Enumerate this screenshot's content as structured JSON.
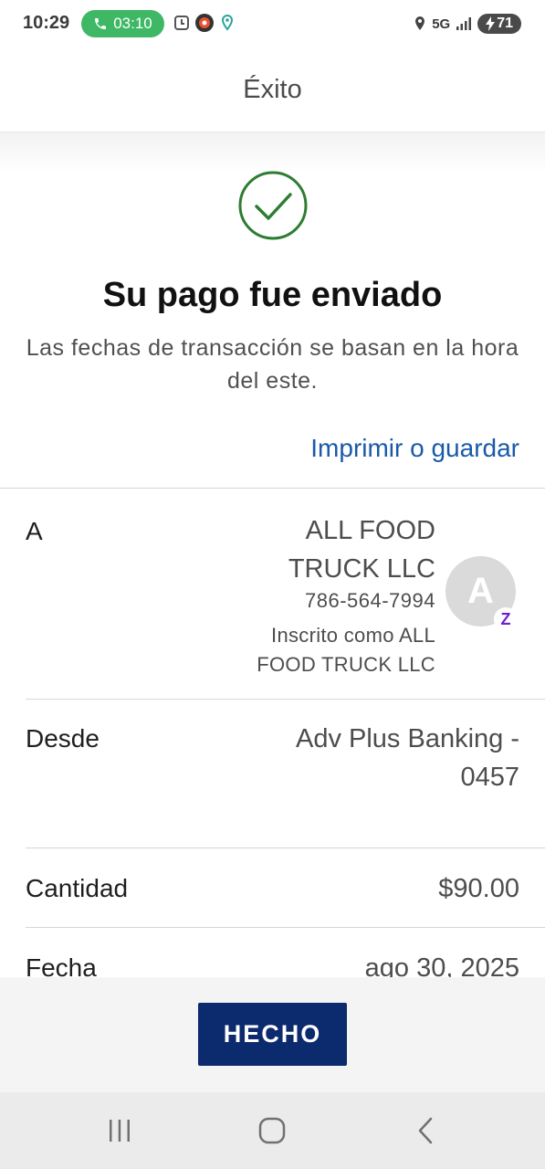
{
  "status_bar": {
    "time": "10:29",
    "call_duration": "03:10",
    "network": "5G",
    "battery": "71",
    "icons": [
      "phone-icon",
      "alarm-icon",
      "app-notification-icon",
      "location-dot-icon",
      "location-icon",
      "signal-icon",
      "charging-icon"
    ]
  },
  "header": {
    "title": "Éxito"
  },
  "confirmation": {
    "title": "Su pago fue enviado",
    "subtitle": "Las fechas de transacción se basan en la hora del este.",
    "print_link": "Imprimir o guardar",
    "accent_color": "#2e7d32"
  },
  "details": {
    "to": {
      "label": "A",
      "name": "ALL FOOD TRUCK LLC",
      "phone": "786-564-7994",
      "enrolled_as": "Inscrito como ALL FOOD TRUCK LLC",
      "avatar_letter": "A",
      "badge": "Z"
    },
    "from": {
      "label": "Desde",
      "value": "Adv Plus Banking - 0457"
    },
    "amount": {
      "label": "Cantidad",
      "value": "$90.00"
    },
    "date": {
      "label": "Fecha",
      "value": "ago 30, 2025"
    }
  },
  "footer": {
    "done_label": "HECHO",
    "button_color": "#0c2a6e"
  },
  "nav": {
    "icons": [
      "recent-apps-icon",
      "home-icon",
      "back-icon"
    ]
  }
}
